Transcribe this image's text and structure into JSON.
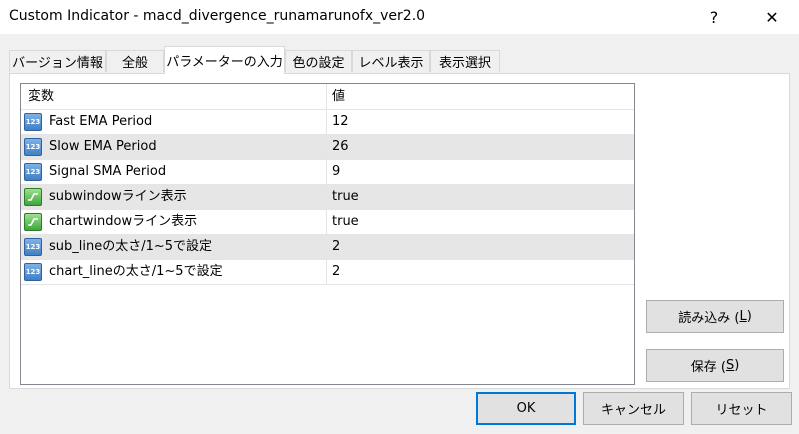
{
  "window": {
    "title": "Custom Indicator - macd_divergence_runamarunofx_ver2.0",
    "help_glyph": "?",
    "close_glyph": "✕"
  },
  "tabs": [
    {
      "label": "バージョン情報",
      "active": false
    },
    {
      "label": "全般",
      "active": false
    },
    {
      "label": "パラメーターの入力",
      "active": true
    },
    {
      "label": "色の設定",
      "active": false
    },
    {
      "label": "レベル表示",
      "active": false
    },
    {
      "label": "表示選択",
      "active": false
    }
  ],
  "grid": {
    "col_variable": "変数",
    "col_value": "値",
    "rows": [
      {
        "icon": "numeric-param-icon",
        "icon_text": "123",
        "name": "Fast EMA Period",
        "value": "12"
      },
      {
        "icon": "numeric-param-icon",
        "icon_text": "123",
        "name": "Slow EMA Period",
        "value": "26"
      },
      {
        "icon": "numeric-param-icon",
        "icon_text": "123",
        "name": "Signal SMA Period",
        "value": "9"
      },
      {
        "icon": "boolean-param-icon",
        "icon_text": "",
        "name": "subwindowライン表示",
        "value": "true"
      },
      {
        "icon": "boolean-param-icon",
        "icon_text": "",
        "name": "chartwindowライン表示",
        "value": "true"
      },
      {
        "icon": "numeric-param-icon",
        "icon_text": "123",
        "name": "sub_lineの太さ/1~5で設定",
        "value": "2"
      },
      {
        "icon": "numeric-param-icon",
        "icon_text": "123",
        "name": "chart_lineの太さ/1~5で設定",
        "value": "2"
      }
    ]
  },
  "buttons": {
    "load_label": "読み込み (",
    "load_key": "L",
    "load_close": ")",
    "save_label": "保存 (",
    "save_key": "S",
    "save_close": ")",
    "ok": "OK",
    "cancel": "キャンセル",
    "reset": "リセット"
  }
}
